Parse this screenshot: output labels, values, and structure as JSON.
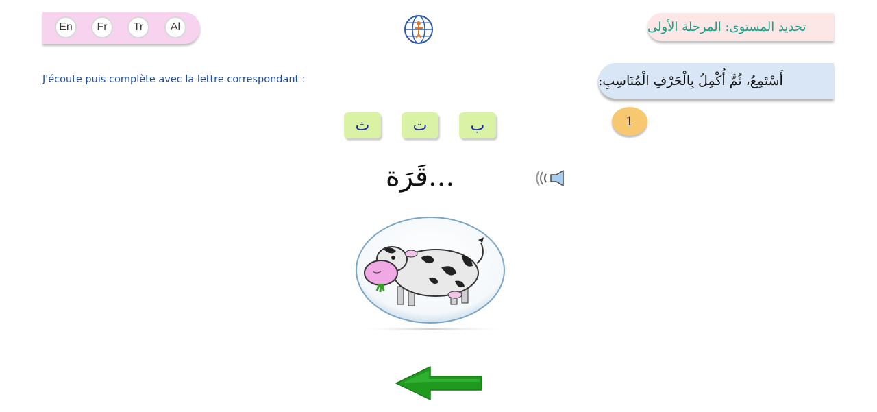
{
  "languages": [
    {
      "label": "En"
    },
    {
      "label": "Fr"
    },
    {
      "label": "Tr"
    },
    {
      "label": "Al"
    }
  ],
  "header": {
    "level_title": "تحديد المستوى: المرحلة الأولى"
  },
  "instructions": {
    "french": "J'écoute puis complète avec la lettre correspondant :",
    "arabic": "أَسْتَمِعُ، ثُمَّ أُكْمِلُ بِالْحَرْفِ الْمُنَاسِبِ:"
  },
  "exercise": {
    "number": "1",
    "letters": [
      "ب",
      "ت",
      "ث"
    ],
    "word": "...قَرَة"
  },
  "icons": {
    "speaker": "speaker-icon",
    "next": "arrow-left-icon",
    "logo": "globe-logo-icon"
  },
  "colors": {
    "lang_bar": "#f7d3ef",
    "level_text": "#1aa088",
    "letter_button": "#d9f2a6",
    "letter_text": "#1c2ea8",
    "badge": "#f8c871",
    "arrow": "#1f9a1f"
  }
}
